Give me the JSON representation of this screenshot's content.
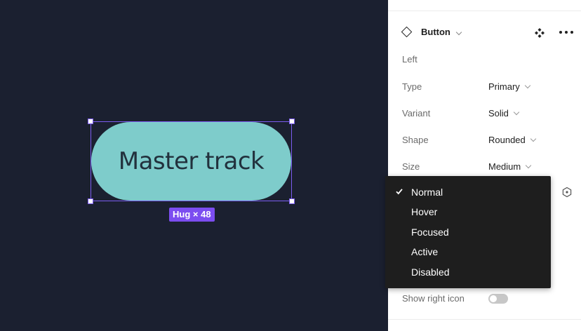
{
  "canvas": {
    "button_label": "Master track",
    "size_badge": "Hug × 48",
    "button_fill": "#7ecccb",
    "selection_color": "#7b5cf0",
    "badge_color": "#7c4df0"
  },
  "panel": {
    "component_name": "Button",
    "section_label": "Left",
    "properties": [
      {
        "name": "Type",
        "value": "Primary"
      },
      {
        "name": "Variant",
        "value": "Solid"
      },
      {
        "name": "Shape",
        "value": "Rounded"
      },
      {
        "name": "Size",
        "value": "Medium"
      }
    ],
    "toggle": {
      "label": "Show right icon",
      "on": false
    },
    "icons": {
      "component": "component-icon",
      "more": "more-icon",
      "instance": "instance-swap-icon"
    }
  },
  "dropdown": {
    "selected": "Normal",
    "options": [
      "Normal",
      "Hover",
      "Focused",
      "Active",
      "Disabled"
    ]
  }
}
